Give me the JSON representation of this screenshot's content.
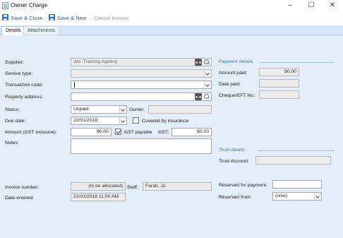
{
  "window": {
    "title": "Owner Charge",
    "minimize": "–",
    "maximize": "☐",
    "close": "✕"
  },
  "toolbar": {
    "save_close": "Save & Close",
    "save_new": "Save & New",
    "cancel_invoice": "Cancel Invoice"
  },
  "tabs": [
    {
      "label": "Details"
    },
    {
      "label": "Attachments"
    }
  ],
  "form": {
    "supplier_label": "Supplier:",
    "supplier_value": "Joc' Training Agency",
    "service_type_label": "Service type:",
    "service_type_value": "",
    "transaction_code_label": "Transaction code:",
    "transaction_code_value": "",
    "property_address_label": "Property address:",
    "property_address_value": "",
    "status_label": "Status:",
    "status_value": "Unpaid",
    "owner_label": "Owner:",
    "owner_value": "",
    "due_date_label": "Due date:",
    "due_date_value": "22/01/2018",
    "covered_label": "Covered by insurance",
    "covered_checked": false,
    "amount_label": "Amount (GST inclusive):",
    "amount_value": "$0.00",
    "gst_payable_label": "GST payable",
    "gst_payable_checked": true,
    "gst_label": "GST:",
    "gst_value": "$0.00",
    "notes_label": "Notes:",
    "notes_value": "",
    "invoice_number_label": "Invoice number:",
    "invoice_number_value": "(to be allocated)",
    "staff_label": "Staff:",
    "staff_value": "Farah, Jo",
    "date_entered_label": "Date entered:",
    "date_entered_value": "22/01/2018 11:00 AM"
  },
  "payment": {
    "title": "Payment details",
    "amount_paid_label": "Amount paid:",
    "amount_paid_value": "$0.00",
    "date_paid_label": "Date paid:",
    "date_paid_value": "",
    "cheque_label": "Cheque/EFT No.:",
    "cheque_value": ""
  },
  "trust": {
    "title": "Trust details",
    "account_label": "Trust Account:",
    "account_value": ""
  },
  "reserve": {
    "reserved_for_payment_label": "Reserved for payment:",
    "reserved_for_payment_value": "",
    "reserved_from_label": "Reserved from:",
    "reserved_from_value": "(now)"
  },
  "colors": {
    "accent": "#2c6fb7",
    "panel_bg": "#e4eefa",
    "section_title": "#3a7bc0"
  },
  "icons": [
    "document-icon",
    "floppy-disk-icon",
    "binoculars-icon",
    "magnifier-icon",
    "chevron-down-icon",
    "checkbox-icon"
  ]
}
